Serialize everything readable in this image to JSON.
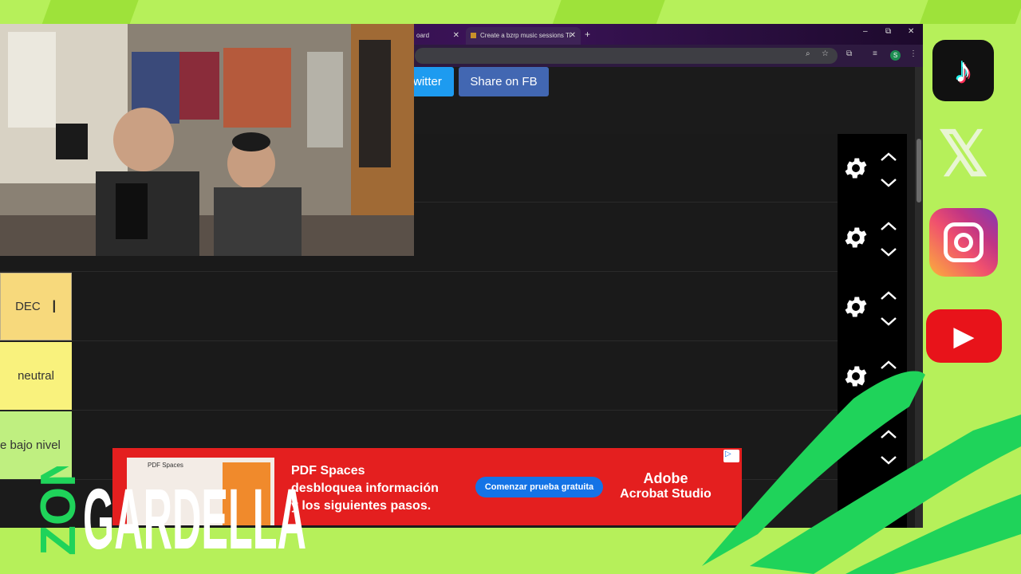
{
  "browser": {
    "tabs": [
      {
        "label": "oard",
        "active": false
      },
      {
        "label": "Create a bzrp music sessions Ti",
        "active": true
      }
    ]
  },
  "share_buttons": {
    "twitter_label": "witter",
    "facebook_label": "Share on FB"
  },
  "tiers": [
    {
      "label": "",
      "color": "#1a1a1a"
    },
    {
      "label": "",
      "color": "#1a1a1a"
    },
    {
      "label": "DEC",
      "color": "#f7d97c"
    },
    {
      "label": "neutral",
      "color": "#f9f27d"
    },
    {
      "label": "e bajo nivel",
      "color": "#bfef80"
    }
  ],
  "ad": {
    "thumb_label": "PDF Spaces",
    "headline": "PDF Spaces",
    "line2": "desbloquea información",
    "line3": "y los siguientes pasos.",
    "cta": "Comenzar prueba gratuita",
    "brand_line1": "Adobe",
    "brand_line2": "Acrobat Studio"
  },
  "overlay": {
    "logo_word1": "ZONA",
    "logo_word2": "GARDELLA"
  },
  "social_icons": [
    "tiktok-icon",
    "x-icon",
    "instagram-icon",
    "youtube-icon"
  ]
}
